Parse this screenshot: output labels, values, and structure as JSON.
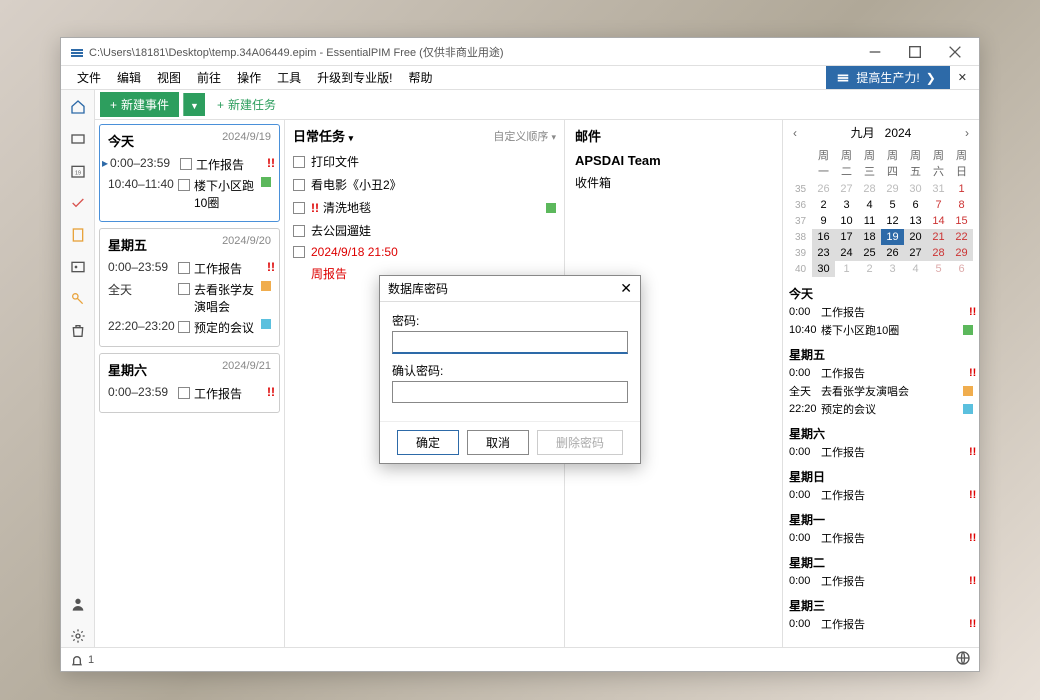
{
  "window": {
    "title": "C:\\Users\\18181\\Desktop\\temp.34A06449.epim - EssentialPIM Free (仅供非商业用途)"
  },
  "menubar": {
    "items": [
      "文件",
      "编辑",
      "视图",
      "前往",
      "操作",
      "工具",
      "升级到专业版!",
      "帮助"
    ],
    "promo": "提高生产力!"
  },
  "toolbar": {
    "new_event": "新建事件",
    "new_task": "新建任务"
  },
  "days": [
    {
      "name": "今天",
      "date": "2024/9/19",
      "today": true,
      "events": [
        {
          "time": "0:00–23:59",
          "text": "工作报告",
          "priority": "!!"
        },
        {
          "time": "10:40–11:40",
          "text": "楼下小区跑10圈",
          "color": "green"
        }
      ]
    },
    {
      "name": "星期五",
      "date": "2024/9/20",
      "today": false,
      "events": [
        {
          "time": "0:00–23:59",
          "text": "工作报告",
          "priority": "!!"
        },
        {
          "time": "全天",
          "text": "去看张学友演唱会",
          "color": "orange"
        },
        {
          "time": "22:20–23:20",
          "text": "预定的会议",
          "color": "blue"
        }
      ]
    },
    {
      "name": "星期六",
      "date": "2024/9/21",
      "today": false,
      "events": [
        {
          "time": "0:00–23:59",
          "text": "工作报告",
          "priority": "!!"
        }
      ]
    }
  ],
  "tasks": {
    "title": "日常任务",
    "sort": "自定义顺序",
    "items": [
      {
        "text": "打印文件"
      },
      {
        "text": "看电影《小丑2》"
      },
      {
        "text": "清洗地毯",
        "priority": "!!",
        "color": "green"
      },
      {
        "text": "去公园遛娃"
      },
      {
        "text": "2024/9/18 21:50",
        "overdue": true,
        "sub": "周报告"
      }
    ]
  },
  "mail": {
    "title": "邮件",
    "team": "APSDAI Team",
    "inbox": "收件箱"
  },
  "calendar": {
    "month": "九月",
    "year": "2024",
    "dow": [
      "周一",
      "周二",
      "周三",
      "周四",
      "周五",
      "周六",
      "周日"
    ],
    "weeks": [
      {
        "wk": "35",
        "d": [
          {
            "n": "26",
            "o": 1
          },
          {
            "n": "27",
            "o": 1
          },
          {
            "n": "28",
            "o": 1
          },
          {
            "n": "29",
            "o": 1
          },
          {
            "n": "30",
            "o": 1
          },
          {
            "n": "31",
            "o": 1
          },
          {
            "n": "1",
            "we": 1
          }
        ]
      },
      {
        "wk": "36",
        "d": [
          {
            "n": "2"
          },
          {
            "n": "3"
          },
          {
            "n": "4"
          },
          {
            "n": "5"
          },
          {
            "n": "6"
          },
          {
            "n": "7",
            "we": 1
          },
          {
            "n": "8",
            "we": 1
          }
        ]
      },
      {
        "wk": "37",
        "d": [
          {
            "n": "9"
          },
          {
            "n": "10"
          },
          {
            "n": "11"
          },
          {
            "n": "12"
          },
          {
            "n": "13"
          },
          {
            "n": "14",
            "we": 1
          },
          {
            "n": "15",
            "we": 1
          }
        ]
      },
      {
        "wk": "38",
        "d": [
          {
            "n": "16",
            "sel": 1
          },
          {
            "n": "17",
            "sel": 1
          },
          {
            "n": "18",
            "sel": 1
          },
          {
            "n": "19",
            "today": 1
          },
          {
            "n": "20",
            "sel": 1
          },
          {
            "n": "21",
            "sel": 1,
            "we": 1
          },
          {
            "n": "22",
            "sel": 1,
            "we": 1
          }
        ]
      },
      {
        "wk": "39",
        "d": [
          {
            "n": "23",
            "sel": 1
          },
          {
            "n": "24",
            "sel": 1
          },
          {
            "n": "25",
            "sel": 1
          },
          {
            "n": "26",
            "sel": 1
          },
          {
            "n": "27",
            "sel": 1
          },
          {
            "n": "28",
            "sel": 1,
            "we": 1
          },
          {
            "n": "29",
            "sel": 1,
            "we": 1
          }
        ]
      },
      {
        "wk": "40",
        "d": [
          {
            "n": "30",
            "sel": 1
          },
          {
            "n": "1",
            "o": 1
          },
          {
            "n": "2",
            "o": 1
          },
          {
            "n": "3",
            "o": 1
          },
          {
            "n": "4",
            "o": 1
          },
          {
            "n": "5",
            "o": 1,
            "we": 1
          },
          {
            "n": "6",
            "o": 1,
            "we": 1
          }
        ]
      }
    ]
  },
  "agenda": [
    {
      "day": "今天",
      "rows": [
        {
          "time": "0:00",
          "text": "工作报告",
          "priority": "!!"
        },
        {
          "time": "10:40",
          "text": "楼下小区跑10圈",
          "color": "green"
        }
      ]
    },
    {
      "day": "星期五",
      "rows": [
        {
          "time": "0:00",
          "text": "工作报告",
          "priority": "!!"
        },
        {
          "time": "全天",
          "text": "去看张学友演唱会",
          "color": "orange"
        },
        {
          "time": "22:20",
          "text": "预定的会议",
          "color": "blue"
        }
      ]
    },
    {
      "day": "星期六",
      "rows": [
        {
          "time": "0:00",
          "text": "工作报告",
          "priority": "!!"
        }
      ]
    },
    {
      "day": "星期日",
      "rows": [
        {
          "time": "0:00",
          "text": "工作报告",
          "priority": "!!"
        }
      ]
    },
    {
      "day": "星期一",
      "rows": [
        {
          "time": "0:00",
          "text": "工作报告",
          "priority": "!!"
        }
      ]
    },
    {
      "day": "星期二",
      "rows": [
        {
          "time": "0:00",
          "text": "工作报告",
          "priority": "!!"
        }
      ]
    },
    {
      "day": "星期三",
      "rows": [
        {
          "time": "0:00",
          "text": "工作报告",
          "priority": "!!"
        }
      ]
    }
  ],
  "dialog": {
    "title": "数据库密码",
    "pwd_label": "密码:",
    "confirm_label": "确认密码:",
    "ok": "确定",
    "cancel": "取消",
    "delete": "删除密码"
  },
  "status": {
    "notif_count": "1"
  }
}
